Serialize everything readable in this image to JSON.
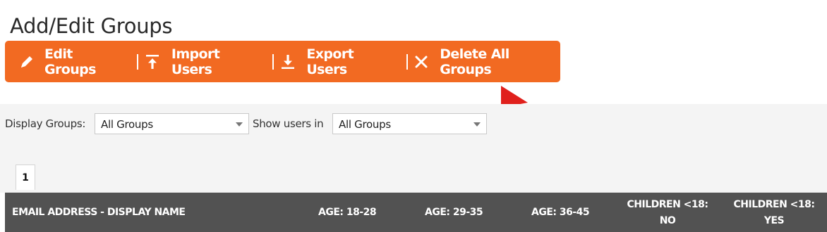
{
  "page": {
    "title": "Add/Edit Groups"
  },
  "toolbar": {
    "edit_groups": "Edit Groups",
    "import_users": "Import Users",
    "export_users": "Export Users",
    "delete_all_groups": "Delete All Groups",
    "bg_color": "#f26a22"
  },
  "filters": {
    "display_groups_label": "Display Groups:",
    "display_groups_value": "All Groups",
    "show_users_label": "Show users in",
    "show_users_value": "All Groups"
  },
  "pagination": {
    "current_page": "1"
  },
  "table": {
    "columns": {
      "email": "EMAIL ADDRESS - DISPLAY NAME",
      "age_18_28": "AGE: 18-28",
      "age_29_35": "AGE: 29-35",
      "age_36_45": "AGE: 36-45",
      "children_no_line1": "CHILDREN <18:",
      "children_no_line2": "NO",
      "children_yes_line1": "CHILDREN <18:",
      "children_yes_line2": "YES"
    },
    "header_bg": "#525252"
  },
  "annotation": {
    "arrow_color": "#e0201c"
  }
}
